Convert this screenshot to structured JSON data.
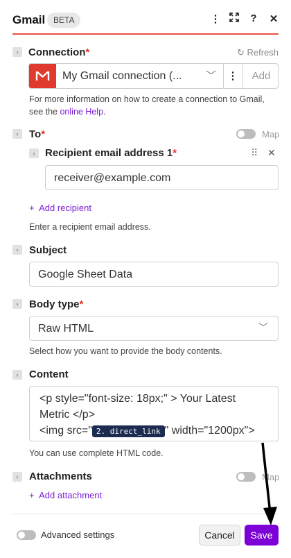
{
  "header": {
    "title": "Gmail",
    "badge": "BETA",
    "help_icon": "?"
  },
  "connection": {
    "label": "Connection",
    "required": "*",
    "refresh": "Refresh",
    "selected": "My Gmail connection (...",
    "add_label": "Add",
    "help_prefix": "For more information on how to create a connection to Gmail, see the ",
    "help_link": "online Help",
    "help_suffix": "."
  },
  "to": {
    "label": "To",
    "required": "*",
    "map_label": "Map",
    "recipient_label": "Recipient email address 1",
    "recipient_value": "receiver@example.com",
    "add_recipient": "Add recipient",
    "help": "Enter a recipient email address."
  },
  "subject": {
    "label": "Subject",
    "value": "Google Sheet Data"
  },
  "body_type": {
    "label": "Body type",
    "required": "*",
    "value": "Raw HTML",
    "help": "Select how you want to provide the body contents."
  },
  "content": {
    "label": "Content",
    "line1": "<p style=\"font-size: 18px;\" > Your Latest",
    "line2": "Metric </p>",
    "line3_prefix": "<img src=\"",
    "pill": "2. direct_link",
    "line3_suffix": "\" width=\"1200px\">",
    "help": "You can use complete HTML code."
  },
  "attachments": {
    "label": "Attachments",
    "map_label": "Map",
    "add_attachment": "Add attachment"
  },
  "footer": {
    "advanced": "Advanced settings",
    "cancel": "Cancel",
    "save": "Save"
  },
  "colors": {
    "accent": "#7d00d6",
    "gmail_red": "#e0392d",
    "header_line": "#ec4f42",
    "required": "#e0332b"
  }
}
